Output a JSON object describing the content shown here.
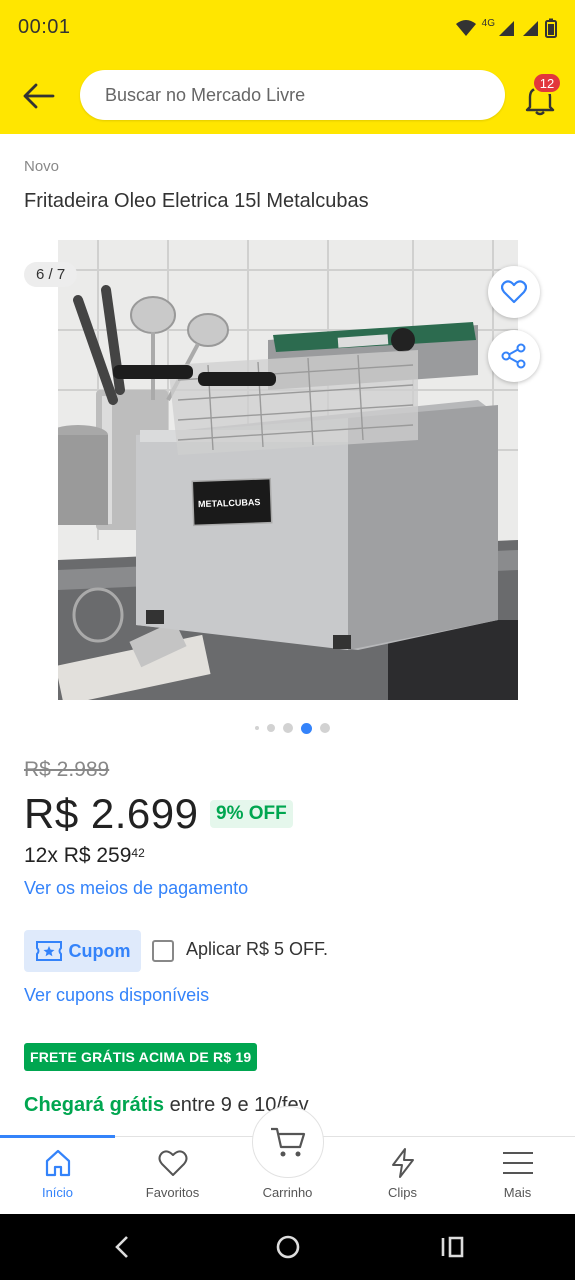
{
  "status_bar": {
    "time": "00:01",
    "network": "4G"
  },
  "header": {
    "search_placeholder": "Buscar no Mercado Livre",
    "notifications_count": "12"
  },
  "product": {
    "condition": "Novo",
    "title": "Fritadeira Oleo Eletrica 15l Metalcubas",
    "image_counter": "6 / 7",
    "image_brand_label": "METALCUBAS",
    "original_price": "R$ 2.989",
    "price": "R$ 2.699",
    "discount": "9% OFF",
    "installments_prefix": "12x R$ 259",
    "installments_cents": "42",
    "payment_link": "Ver os meios de pagamento",
    "coupon_label": "Cupom",
    "coupon_apply_label": "Aplicar R$ 5 OFF.",
    "coupons_link": "Ver cupons disponíveis",
    "free_shipping_badge": "FRETE GRÁTIS ACIMA DE R$ 19",
    "arrival_strong": "Chegará grátis",
    "arrival_rest": " entre 9 e 10/fev"
  },
  "carousel": {
    "total_dots": 5,
    "active_dot": 4
  },
  "bottom_nav": {
    "items": [
      {
        "label": "Início",
        "icon": "home-icon",
        "active": true
      },
      {
        "label": "Favoritos",
        "icon": "heart-icon",
        "active": false
      },
      {
        "label": "Carrinho",
        "icon": "cart-icon",
        "active": false
      },
      {
        "label": "Clips",
        "icon": "bolt-icon",
        "active": false
      },
      {
        "label": "Mais",
        "icon": "menu-icon",
        "active": false
      }
    ]
  },
  "colors": {
    "brand_yellow": "#ffe600",
    "link_blue": "#3483fa",
    "success_green": "#00a650",
    "badge_red": "#e2363c"
  }
}
